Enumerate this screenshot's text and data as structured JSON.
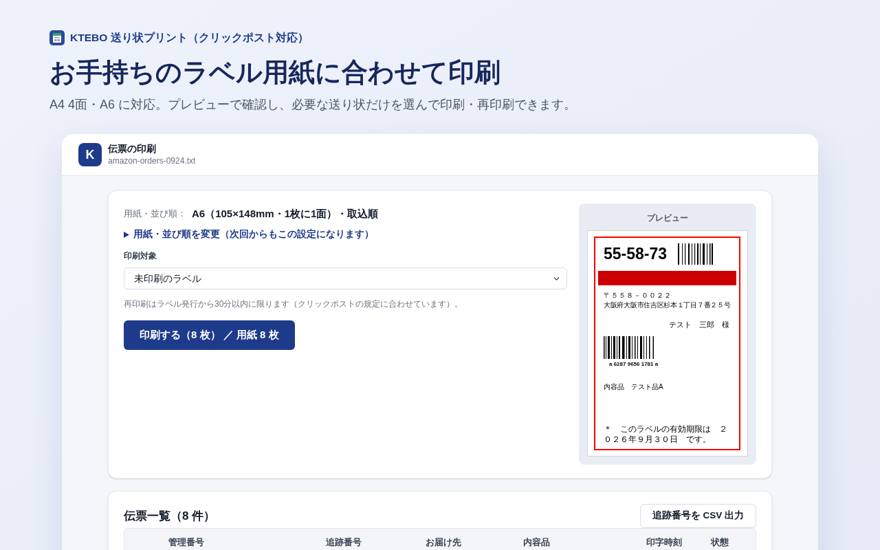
{
  "brand": {
    "name": "KTEBO 送り状プリント（クリックポスト対応）"
  },
  "headline": "お手持ちのラベル用紙に合わせて印刷",
  "subtitle": "A4 4面・A6 に対応。プレビューで確認し、必要な送り状だけを選んで印刷・再印刷できます。",
  "window": {
    "logo_letter": "K",
    "title": "伝票の印刷",
    "filename": "amazon-orders-0924.txt"
  },
  "print_panel": {
    "paper_setting": {
      "label": "用紙・並び順：",
      "value": "A6（105×148mm・1枚に1面）・取込順"
    },
    "change_settings": {
      "label": "用紙・並び順を変更（次回からもこの設定になります）",
      "expanded": false
    },
    "target": {
      "label": "印刷対象",
      "value": "未印刷のラベル"
    },
    "note": "再印刷はラベル発行から30分以内に限ります（クリックポストの規定に合わせています）。",
    "print_button": "印刷する（8 枚） ／ 用紙 8 枚"
  },
  "preview": {
    "title": "プレビュー",
    "label": {
      "sort_code": "55-58-73",
      "postal_code": "〒５５８－００２２",
      "address": "大阪府大阪市住吉区杉本１丁目７番２５号",
      "recipient": "テスト　三郎　様",
      "tracking_number": "a 6287 9656 1781 a",
      "contents": "内容品　テスト品A",
      "expiry_note": "＊　このラベルの有効期限は　２０２６年９月３０日　です。"
    }
  },
  "slip_list": {
    "title": "伝票一覧（8 件）",
    "export_button": "追跡番号を CSV 出力",
    "columns": [
      "管理番号",
      "追跡番号",
      "お届け先",
      "内容品",
      "印字時刻",
      "状態"
    ]
  }
}
